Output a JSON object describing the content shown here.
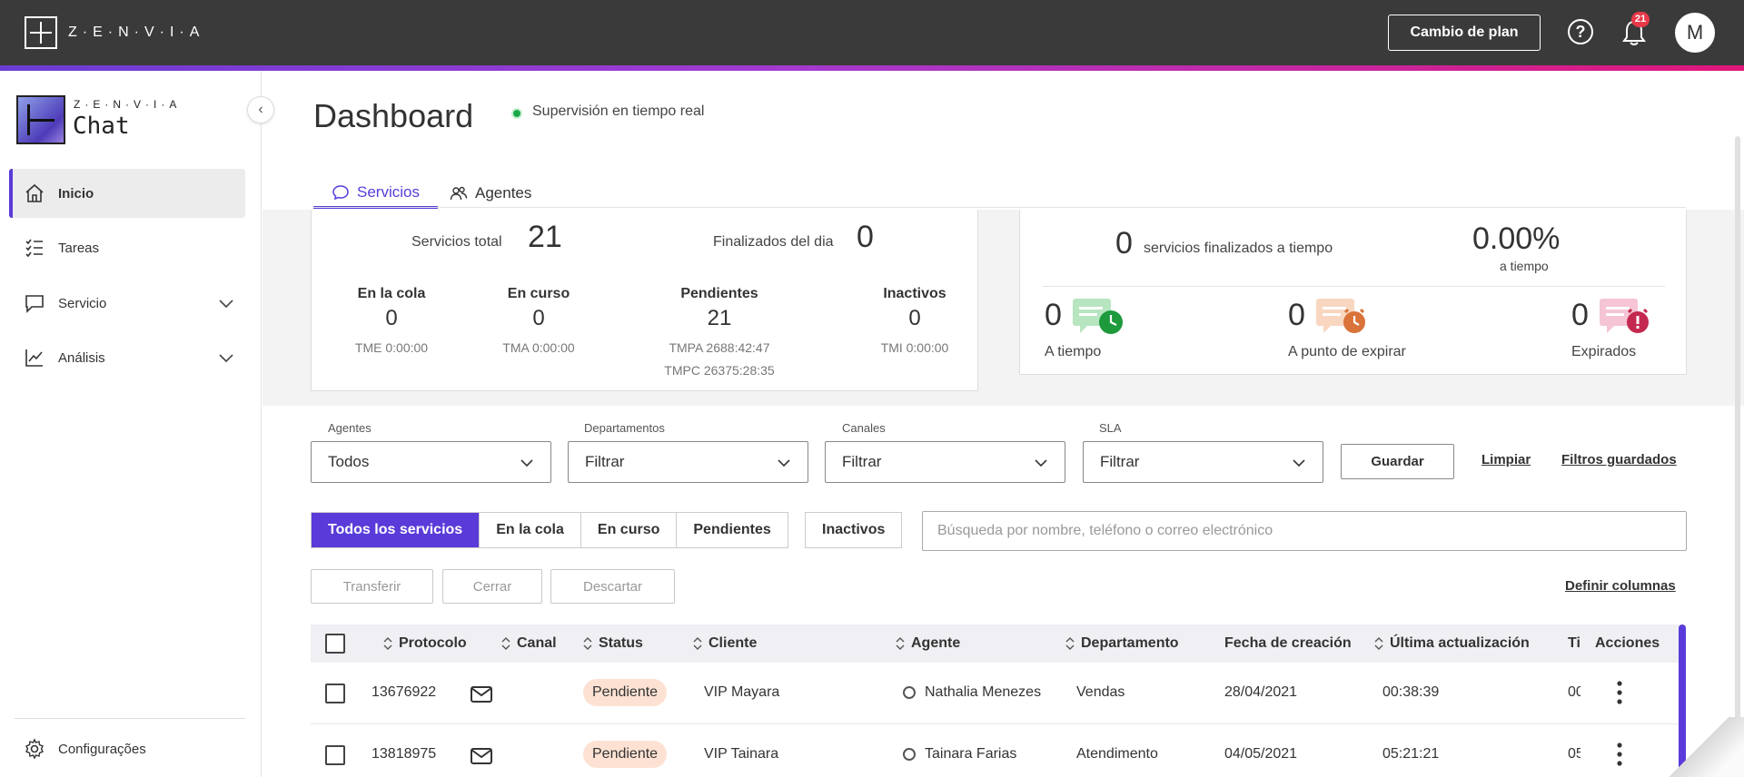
{
  "app": {
    "brand": "Z·E·N·V·I·A",
    "plan_button": "Cambio de plan",
    "notifications_count": "21",
    "avatar_initial": "M"
  },
  "sidebar": {
    "logo_sub": "Z·E·N·V·I·A",
    "logo_product": "Chat",
    "items": [
      {
        "label": "Inicio",
        "icon": "home-icon",
        "active": true
      },
      {
        "label": "Tareas",
        "icon": "tasks-icon"
      },
      {
        "label": "Servicio",
        "icon": "chat-icon",
        "expandable": true
      },
      {
        "label": "Análisis",
        "icon": "analytics-icon",
        "expandable": true
      }
    ],
    "footer_item": {
      "label": "Configurações",
      "icon": "gear-icon"
    }
  },
  "header": {
    "title": "Dashboard",
    "live_status": "Supervisión en tiempo real"
  },
  "tabs": [
    {
      "label": "Servicios",
      "icon": "chat-bubble-icon",
      "active": true
    },
    {
      "label": "Agentes",
      "icon": "users-icon"
    }
  ],
  "stats": {
    "total_label": "Servicios total",
    "total_value": "21",
    "finished_label": "Finalizados del dia",
    "finished_value": "0",
    "columns": [
      {
        "label": "En la cola",
        "value": "0",
        "sub": [
          "TME 0:00:00"
        ]
      },
      {
        "label": "En curso",
        "value": "0",
        "sub": [
          "TMA 0:00:00"
        ]
      },
      {
        "label": "Pendientes",
        "value": "21",
        "sub": [
          "TMPA 2688:42:47",
          "TMPC 26375:28:35"
        ]
      },
      {
        "label": "Inactivos",
        "value": "0",
        "sub": [
          "TMI 0:00:00"
        ]
      }
    ]
  },
  "sla": {
    "finished_on_time_value": "0",
    "finished_on_time_label": "servicios finalizados a tiempo",
    "percent_value": "0.00%",
    "percent_label": "a tiempo",
    "items": [
      {
        "value": "0",
        "label": "A tiempo",
        "icon": "on-time-icon",
        "color": "#1e9a3c"
      },
      {
        "value": "0",
        "label": "A punto de expirar",
        "icon": "about-to-expire-icon",
        "color": "#d9733a"
      },
      {
        "value": "0",
        "label": "Expirados",
        "icon": "expired-icon",
        "color": "#c42850"
      }
    ]
  },
  "filters": {
    "agents_label": "Agentes",
    "agents_value": "Todos",
    "departments_label": "Departamentos",
    "departments_value": "Filtrar",
    "channels_label": "Canales",
    "channels_value": "Filtrar",
    "sla_label": "SLA",
    "sla_value": "Filtrar",
    "save_button": "Guardar",
    "clear_link": "Limpiar",
    "saved_filters_link": "Filtros guardados"
  },
  "segments": {
    "group": [
      "Todos los servicios",
      "En la cola",
      "En curso",
      "Pendientes"
    ],
    "inactive": "Inactivos",
    "search_placeholder": "Búsqueda por nombre, teléfono o correo electrónico"
  },
  "actions": {
    "transfer": "Transferir",
    "close": "Cerrar",
    "discard": "Descartar",
    "define_columns": "Definir columnas"
  },
  "table": {
    "headers": {
      "protocol": "Protocolo",
      "channel": "Canal",
      "status": "Status",
      "client": "Cliente",
      "agent": "Agente",
      "department": "Departamento",
      "created": "Fecha de creación",
      "updated": "Última actualización",
      "truncated": "Ti",
      "actions": "Acciones"
    },
    "rows": [
      {
        "protocol": "13676922",
        "channel": "email-icon",
        "status": "Pendiente",
        "client": "VIP Mayara",
        "agent": "Nathalia Menezes",
        "department": "Vendas",
        "created": "28/04/2021",
        "updated": "00:38:39",
        "truncated": "00"
      },
      {
        "protocol": "13818975",
        "channel": "email-icon",
        "status": "Pendiente",
        "client": "VIP Tainara",
        "agent": "Tainara Farias",
        "department": "Atendimento",
        "created": "04/05/2021",
        "updated": "05:21:21",
        "truncated": "05"
      }
    ]
  }
}
